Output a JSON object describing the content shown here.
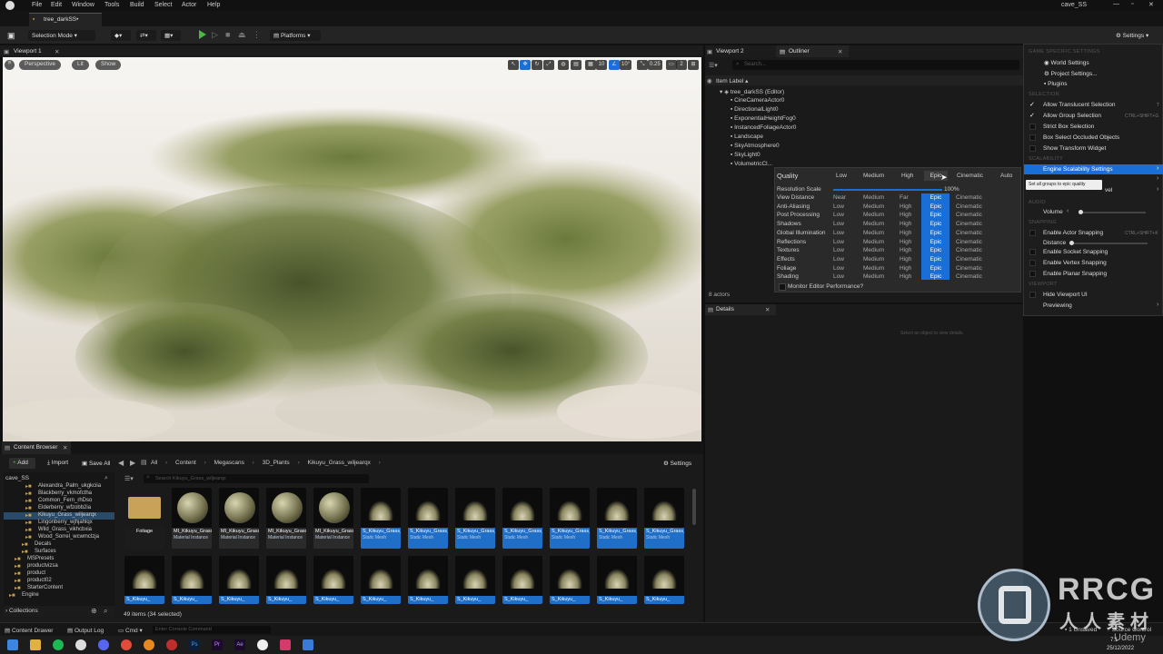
{
  "menubar": {
    "items": [
      "File",
      "Edit",
      "Window",
      "Tools",
      "Build",
      "Select",
      "Actor",
      "Help"
    ],
    "window_title": "cave_SS"
  },
  "project_tab": "tree_darkSS•",
  "toolbar": {
    "selection_mode": "Selection Mode",
    "platforms": "Platforms",
    "settings": "Settings"
  },
  "viewport": {
    "tab": "Viewport 1",
    "perspective": "Perspective",
    "lit": "Lit",
    "show": "Show",
    "snap_grid": "10",
    "snap_rot": "10°",
    "snap_scale": "0.25",
    "cam_speed": "2"
  },
  "right_tabs": {
    "viewport2": "Viewport 2",
    "outliner": "Outliner"
  },
  "outliner": {
    "search_placeholder": "Search...",
    "header": "Item Label ▴",
    "root": "tree_darkSS (Editor)",
    "items": [
      "CineCameraActor0",
      "DirectionalLight0",
      "ExponentialHeightFog0",
      "InstancedFoliageActor0",
      "Landscape",
      "SkyAtmosphere0",
      "SkyLight0",
      "VolumetricCl..."
    ],
    "count": "8 actors"
  },
  "details": {
    "tab": "Details",
    "empty": "Select an object to view details."
  },
  "scalability": {
    "title": "Quality",
    "levels": [
      "Low",
      "Medium",
      "High",
      "Epic",
      "Cinematic",
      "Auto"
    ],
    "resolution_label": "Resolution Scale",
    "resolution_value": "100%",
    "rows": [
      {
        "name": "View Distance",
        "vals": [
          "Near",
          "Medium",
          "Far",
          "Epic",
          "Cinematic"
        ]
      },
      {
        "name": "Anti-Aliasing",
        "vals": [
          "Low",
          "Medium",
          "High",
          "Epic",
          "Cinematic"
        ]
      },
      {
        "name": "Post Processing",
        "vals": [
          "Low",
          "Medium",
          "High",
          "Epic",
          "Cinematic"
        ]
      },
      {
        "name": "Shadows",
        "vals": [
          "Low",
          "Medium",
          "High",
          "Epic",
          "Cinematic"
        ]
      },
      {
        "name": "Global Illumination",
        "vals": [
          "Low",
          "Medium",
          "High",
          "Epic",
          "Cinematic"
        ]
      },
      {
        "name": "Reflections",
        "vals": [
          "Low",
          "Medium",
          "High",
          "Epic",
          "Cinematic"
        ]
      },
      {
        "name": "Textures",
        "vals": [
          "Low",
          "Medium",
          "High",
          "Epic",
          "Cinematic"
        ]
      },
      {
        "name": "Effects",
        "vals": [
          "Low",
          "Medium",
          "High",
          "Epic",
          "Cinematic"
        ]
      },
      {
        "name": "Foliage",
        "vals": [
          "Low",
          "Medium",
          "High",
          "Epic",
          "Cinematic"
        ]
      },
      {
        "name": "Shading",
        "vals": [
          "Low",
          "Medium",
          "High",
          "Epic",
          "Cinematic"
        ]
      }
    ],
    "monitor": "Monitor Editor Performance?",
    "tooltip": "Set all groups to epic quality"
  },
  "settings_menu": {
    "head1": "GAME SPECIFIC SETTINGS",
    "world": "World Settings",
    "project": "Project Settings...",
    "plugins": "Plugins",
    "head2": "SELECTION",
    "translucent": "Allow Translucent Selection",
    "translucent_key": "T",
    "group": "Allow Group Selection",
    "group_key": "CTRL+SHIFT+G",
    "strict": "Strict Box Selection",
    "occluded": "Box Select Occluded Objects",
    "widget": "Show Transform Widget",
    "head3": "SCALABILITY",
    "engine": "Engine Scalability Settings",
    "mat_level_suffix": "vel",
    "head4": "AUDIO",
    "volume": "Volume",
    "head5": "SNAPPING",
    "actor_snap": "Enable Actor Snapping",
    "actor_snap_key": "CTRL+SHIFT+K",
    "distance": "Distance",
    "socket": "Enable Socket Snapping",
    "vertex": "Enable Vertex Snapping",
    "planar": "Enable Planar Snapping",
    "head6": "VIEWPORT",
    "hide_ui": "Hide Viewport UI",
    "previewing": "Previewing"
  },
  "content_browser": {
    "tab": "Content Browser",
    "add": "Add",
    "import": "Import",
    "save_all": "Save All",
    "path": [
      "All",
      "Content",
      "Megascans",
      "3D_Plants",
      "Kikuyu_Grass_wiljearqx"
    ],
    "settings": "Settings",
    "root": "cave_SS",
    "search_placeholder": "Search Kikuyu_Grass_wiljearqx",
    "folders": [
      "Alexandra_Palm_ukgkciia",
      "Blackberry_vkmofctha",
      "Common_Fern_rhDso",
      "Elderberry_wfzobb2ia",
      "Kikuyu_Grass_wiljearqx",
      "Lingonberry_wjhjahlqx",
      "Wild_Grass_vikhcbxia",
      "Wood_Sorrel_wcwmclzja",
      "Decals",
      "Surfaces",
      "MSPresets",
      "productvizsa",
      "product",
      "product02",
      "StarterContent",
      "Engine"
    ],
    "collections": "Collections",
    "count": "49 items (34 selected)",
    "assets_row1": [
      {
        "name": "Foliage",
        "kind": "folder"
      },
      {
        "name": "MI_Kikuyu_Grass_",
        "type": "Material Instance",
        "kind": "mi"
      },
      {
        "name": "MI_Kikuyu_Grass_",
        "type": "Material Instance",
        "kind": "mi"
      },
      {
        "name": "MI_Kikuyu_Grass_",
        "type": "Material Instance",
        "kind": "mi"
      },
      {
        "name": "MI_Kikuyu_Grass_",
        "type": "Material Instance",
        "kind": "mi"
      },
      {
        "name": "S_Kikuyu_Grass_",
        "type": "Static Mesh",
        "kind": "sm"
      },
      {
        "name": "S_Kikuyu_Grass_",
        "type": "Static Mesh",
        "kind": "sm"
      },
      {
        "name": "S_Kikuyu_Grass_",
        "type": "Static Mesh",
        "kind": "sm"
      },
      {
        "name": "S_Kikuyu_Grass_",
        "type": "Static Mesh",
        "kind": "sm"
      },
      {
        "name": "S_Kikuyu_Grass_",
        "type": "Static Mesh",
        "kind": "sm"
      },
      {
        "name": "S_Kikuyu_Grass_",
        "type": "Static Mesh",
        "kind": "sm"
      },
      {
        "name": "S_Kikuyu_Grass_",
        "type": "Static Mesh",
        "kind": "sm"
      }
    ],
    "row2_label": "S_Kikuyu_"
  },
  "statusbar": {
    "drawer": "Content Drawer",
    "output": "Output Log",
    "cmd": "Cmd",
    "console_placeholder": "Enter Console Command",
    "unsaved": "1 Unsaved",
    "source": "Source Control"
  },
  "taskbar": {
    "time": "7:1",
    "date": "25/12/2022"
  },
  "watermark": {
    "brand": "RRCG",
    "sub": "人人素材",
    "udemy": "Udemy"
  },
  "colors": {
    "accent": "#1a6fd6",
    "play": "#49b93f"
  }
}
